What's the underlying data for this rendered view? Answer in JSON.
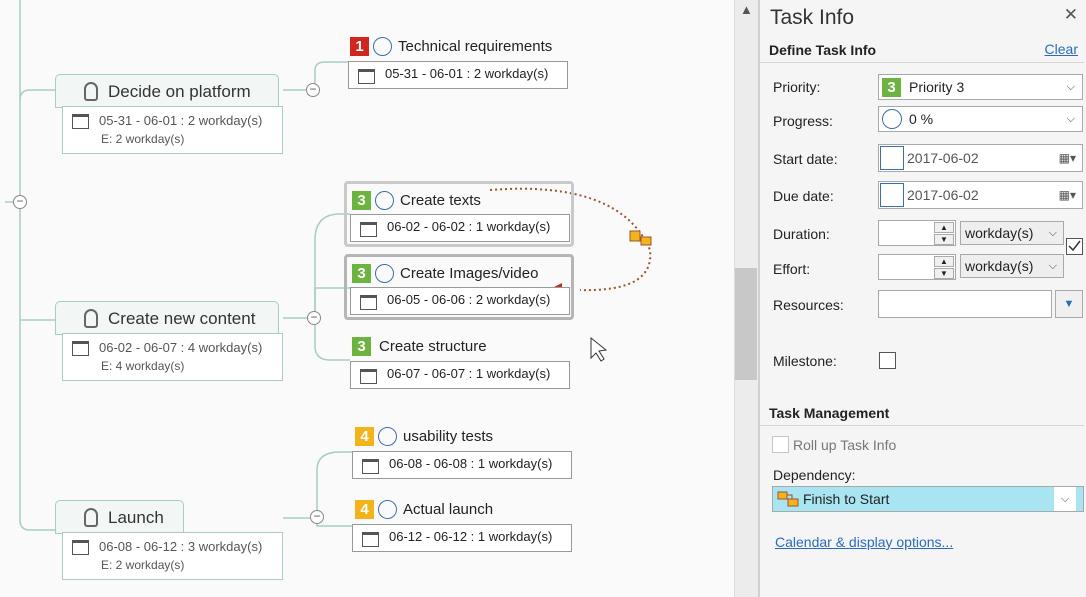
{
  "map": {
    "topics": [
      {
        "name": "Decide on platform",
        "dates": "05-31 - 06-01 : 2 workday(s)",
        "effort": "E: 2 workday(s)"
      },
      {
        "name": "Create new content",
        "dates": "06-02 - 06-07 : 4 workday(s)",
        "effort": "E: 4 workday(s)"
      },
      {
        "name": "Launch",
        "dates": "06-08 - 06-12 : 3 workday(s)",
        "effort": "E: 2 workday(s)"
      }
    ],
    "tasks": [
      {
        "priority": "1",
        "priority_color": "#d0261e",
        "name": "Technical requirements",
        "dates": "05-31 - 06-01 : 2 workday(s)"
      },
      {
        "priority": "3",
        "priority_color": "#6db33f",
        "name": "Create texts",
        "dates": "06-02 - 06-02 : 1 workday(s)"
      },
      {
        "priority": "3",
        "priority_color": "#6db33f",
        "name": "Create Images/video",
        "dates": "06-05 - 06-06 : 2 workday(s)"
      },
      {
        "priority": "3",
        "priority_color": "#6db33f",
        "name": "Create structure",
        "dates": "06-07 - 06-07 : 1 workday(s)"
      },
      {
        "priority": "4",
        "priority_color": "#f2b41a",
        "name": "usability tests",
        "dates": "06-08 - 06-08 : 1 workday(s)"
      },
      {
        "priority": "4",
        "priority_color": "#f2b41a",
        "name": "Actual launch",
        "dates": "06-12 - 06-12 : 1 workday(s)"
      }
    ],
    "collapse_symbol": "−"
  },
  "panel": {
    "title": "Task Info",
    "close": "✕",
    "define_section": "Define Task Info",
    "clear": "Clear",
    "priority_label": "Priority:",
    "priority_num": "3",
    "priority_value": "Priority 3",
    "progress_label": "Progress:",
    "progress_value": "0 %",
    "start_label": "Start date:",
    "start_value": "2017-06-02",
    "due_label": "Due date:",
    "due_value": "2017-06-02",
    "duration_label": "Duration:",
    "duration_unit": "workday(s)",
    "effort_label": "Effort:",
    "effort_unit": "workday(s)",
    "resources_label": "Resources:",
    "milestone_label": "Milestone:",
    "management_section": "Task Management",
    "rollup_label": "Roll up Task Info",
    "dependency_label": "Dependency:",
    "dependency_value": "Finish to Start",
    "calendar_link": "Calendar & display options..."
  },
  "colors": {
    "accent": "#2a6bbf",
    "dependency_line": "#a0522d",
    "selection": "#a9e4f2"
  }
}
